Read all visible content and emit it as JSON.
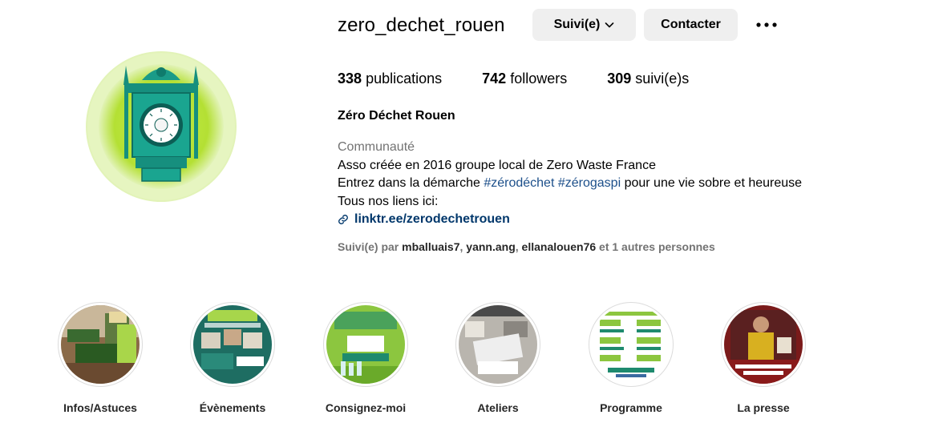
{
  "profile": {
    "username": "zero_dechet_rouen",
    "full_name": "Zéro Déchet Rouen",
    "buttons": {
      "follow": "Suivi(e)",
      "contact": "Contacter"
    },
    "stats": [
      {
        "value": "338",
        "label": "publications"
      },
      {
        "value": "742",
        "label": "followers"
      },
      {
        "value": "309",
        "label": "suivi(e)s"
      }
    ],
    "bio": {
      "category": "Communauté",
      "line1": "Asso créée en 2016 groupe local de Zero Waste France",
      "line2_before": "Entrez dans la démarche ",
      "hashtag1": "#zérodéchet",
      "hashtag2": "#zérogaspi",
      "line2_after": " pour une vie sobre et heureuse",
      "line3": "Tous nos liens ici:",
      "link": "linktr.ee/zerodechetrouen"
    },
    "followed_by": {
      "prefix": "Suivi(e) par ",
      "users": [
        "mballuais7",
        "yann.ang",
        "ellanalouen76"
      ],
      "suffix": " et 1 autres personnes"
    }
  },
  "highlights": [
    {
      "label": "Infos/Astuces"
    },
    {
      "label": "Évènements"
    },
    {
      "label": "Consignez-moi"
    },
    {
      "label": "Ateliers"
    },
    {
      "label": "Programme"
    },
    {
      "label": "La presse"
    }
  ],
  "icons": {
    "chevron": "chevron-down-icon",
    "more": "more-horizontal-icon",
    "link": "link-icon"
  },
  "colors": {
    "accent_link": "#00376b",
    "button_bg": "#efefef",
    "muted": "#737373"
  }
}
